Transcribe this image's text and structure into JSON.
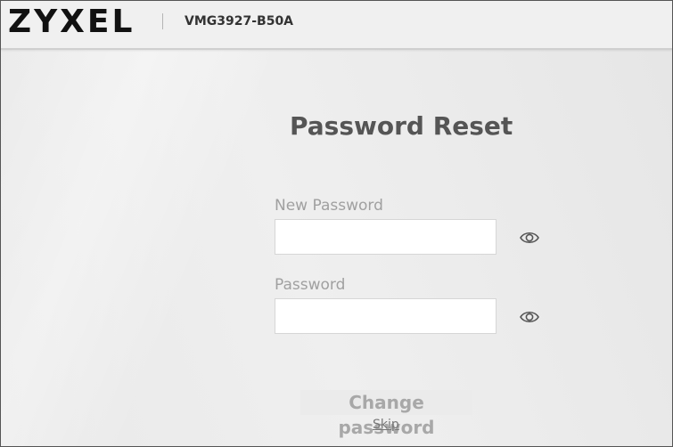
{
  "header": {
    "logo": "ZYXEL",
    "model": "VMG3927-B50A"
  },
  "form": {
    "title": "Password Reset",
    "new_password_label": "New Password",
    "new_password_value": "",
    "password_label": "Password",
    "password_value": "",
    "show_password_icon": "eye-icon",
    "submit_label": "Change password",
    "skip_label": "Skip"
  }
}
